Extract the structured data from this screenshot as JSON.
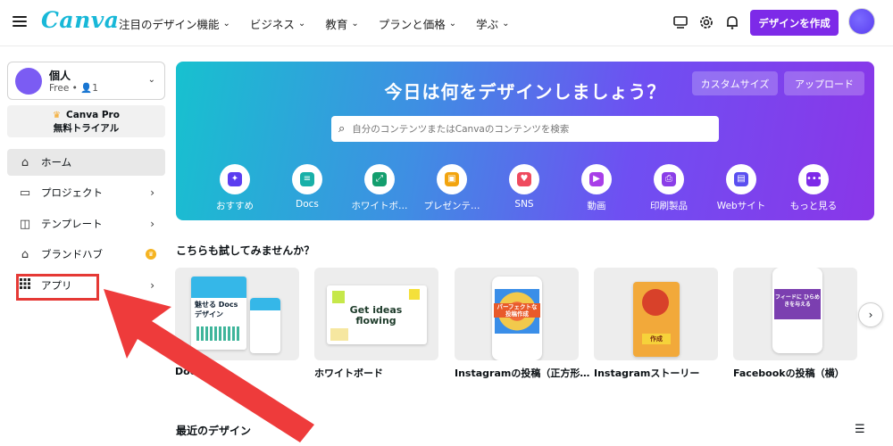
{
  "topbar": {
    "logo": "Canva",
    "nav": [
      {
        "label": "注目のデザイン機能"
      },
      {
        "label": "ビジネス"
      },
      {
        "label": "教育"
      },
      {
        "label": "プランと価格"
      },
      {
        "label": "学ぶ"
      }
    ],
    "create_button": "デザインを作成",
    "icons": [
      "desktop-icon",
      "gear-icon",
      "bell-icon"
    ]
  },
  "sidebar": {
    "account": {
      "name": "個人",
      "plan": "Free • 👤1"
    },
    "pro": {
      "line1": "Canva Pro",
      "line2": "無料トライアル"
    },
    "items": [
      {
        "label": "ホーム",
        "icon": "home-icon"
      },
      {
        "label": "プロジェクト",
        "icon": "folder-icon"
      },
      {
        "label": "テンプレート",
        "icon": "template-icon"
      },
      {
        "label": "ブランドハブ",
        "icon": "brand-icon"
      },
      {
        "label": "アプリ",
        "icon": "apps-grid-icon"
      }
    ]
  },
  "hero": {
    "title": "今日は何をデザインしましょう？",
    "custom_size": "カスタムサイズ",
    "upload": "アップロード",
    "search_placeholder": "自分のコンテンツまたはCanvaのコンテンツを検索",
    "categories": [
      {
        "label": "おすすめ",
        "color": "#5b3df0"
      },
      {
        "label": "Docs",
        "color": "#18b0a8"
      },
      {
        "label": "ホワイトボ…",
        "color": "#139e6d"
      },
      {
        "label": "プレゼンテ…",
        "color": "#f2a40f"
      },
      {
        "label": "SNS",
        "color": "#ef4a5e"
      },
      {
        "label": "動画",
        "color": "#a83ee8"
      },
      {
        "label": "印刷製品",
        "color": "#8b3ee8"
      },
      {
        "label": "Webサイト",
        "color": "#5a4ff0"
      },
      {
        "label": "もっと見る",
        "color": "#7d2ae8"
      }
    ]
  },
  "try_section": {
    "title": "こちらも試してみませんか？",
    "cards": [
      {
        "label": "Doc",
        "thumb_text": "魅せる Docsデザイン"
      },
      {
        "label": "ホワイトボード",
        "thumb_text": "Get ideas flowing"
      },
      {
        "label": "Instagramの投稿（正方形…",
        "thumb_text": "パーフェクトな 投稿作成"
      },
      {
        "label": "Instagramストーリー",
        "thumb_text": "作成"
      },
      {
        "label": "Facebookの投稿（横）",
        "thumb_text": "フィードに ひらめきを与える"
      }
    ]
  },
  "recent": {
    "title": "最近のデザイン"
  },
  "colors": {
    "accent": "#7d2ae8",
    "highlight": "#e53935"
  }
}
